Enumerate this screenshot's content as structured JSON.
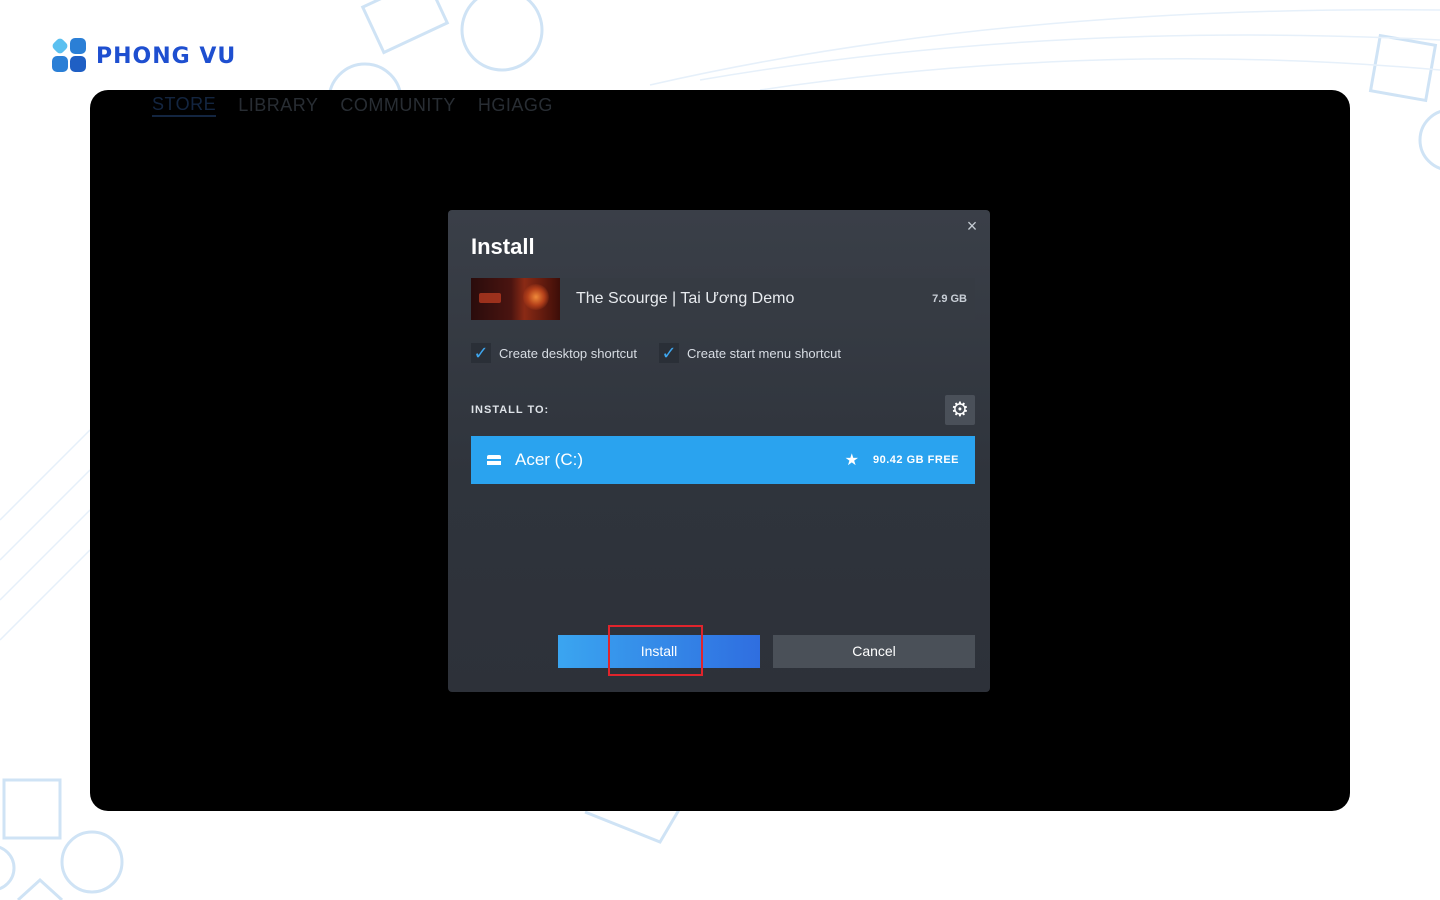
{
  "brand": {
    "name": "PHONG VU",
    "color": "#1e4fd0"
  },
  "background_nav": {
    "items": [
      "STORE",
      "LIBRARY",
      "COMMUNITY",
      "HGIAGG"
    ]
  },
  "dialog": {
    "title": "Install",
    "close_icon": "×",
    "game": {
      "name": "The Scourge | Tai Ương Demo",
      "size": "7.9 GB"
    },
    "checkboxes": [
      {
        "label": "Create desktop shortcut",
        "checked": true
      },
      {
        "label": "Create start menu shortcut",
        "checked": true
      }
    ],
    "install_to_label": "INSTALL TO:",
    "settings_icon": "⚙",
    "drive": {
      "name": "Acer (C:)",
      "free": "90.42 GB FREE",
      "star_icon": "★"
    },
    "buttons": {
      "install": "Install",
      "cancel": "Cancel"
    }
  },
  "colors": {
    "accent": "#2aa3ef",
    "highlight": "#e0242c",
    "dialog_bg": "#353a42"
  }
}
